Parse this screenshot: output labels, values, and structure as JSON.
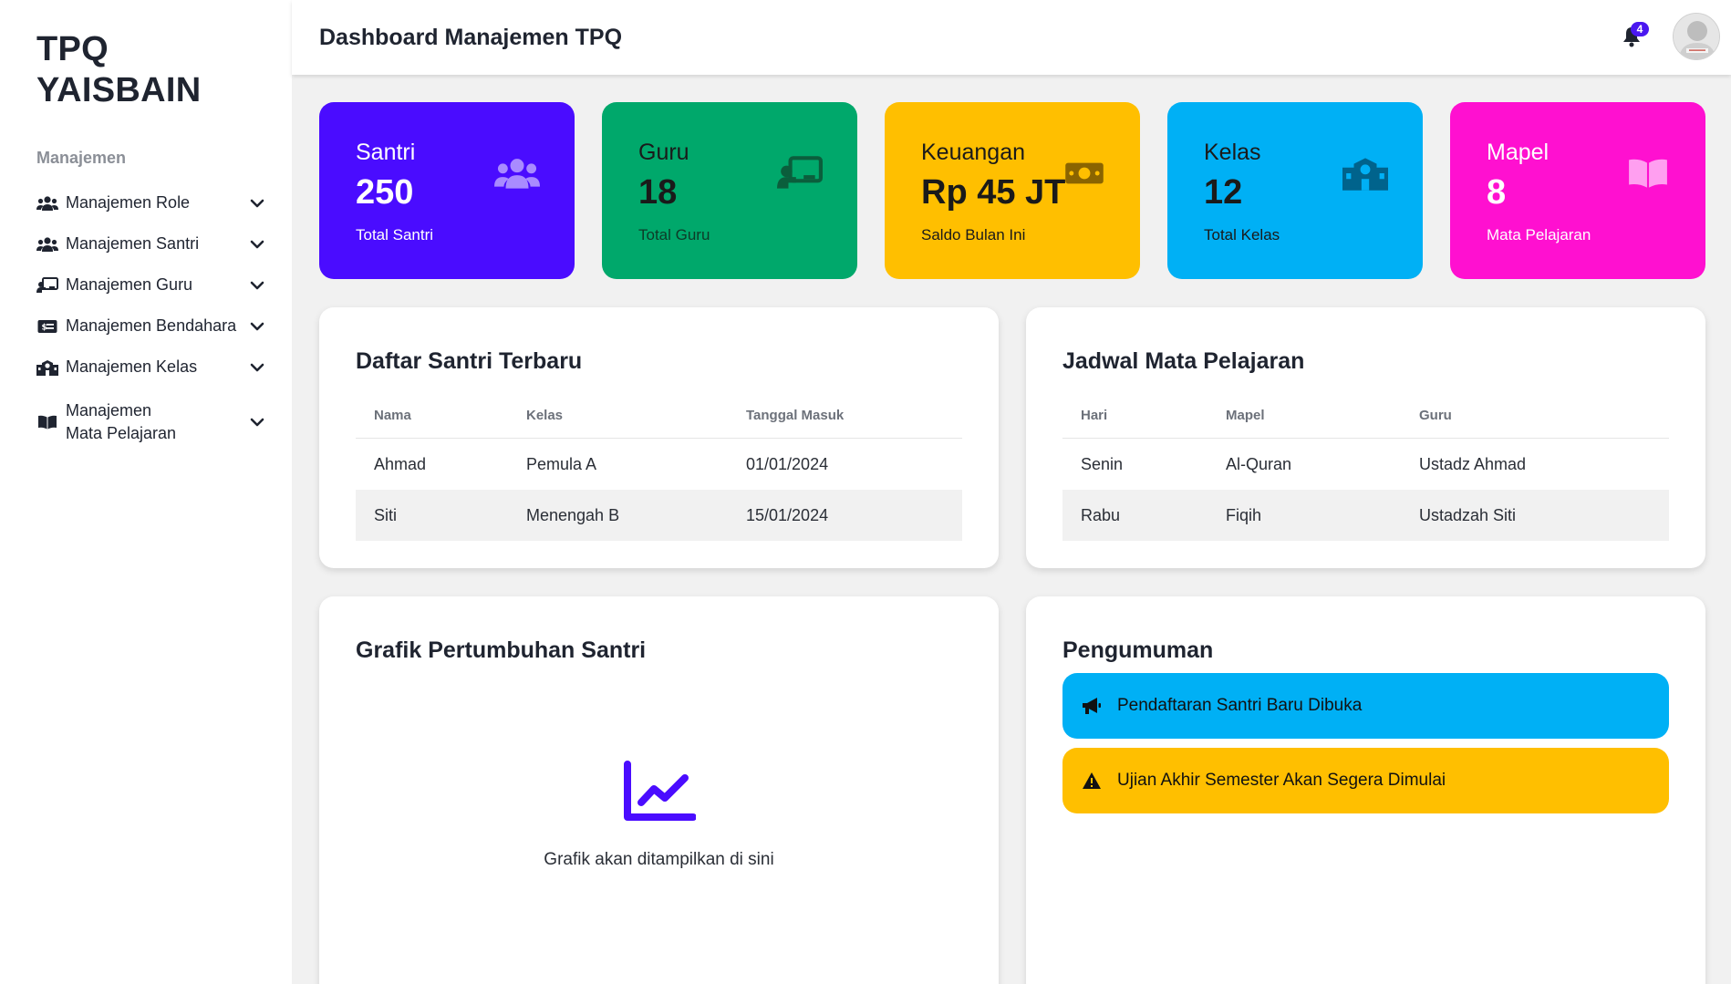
{
  "brand": {
    "line1": "TPQ",
    "line2": "YAISBAIN"
  },
  "sidebar": {
    "section_label": "Manajemen",
    "items": [
      {
        "label": "Manajemen Role",
        "icon": "users-icon"
      },
      {
        "label": "Manajemen Santri",
        "icon": "users-icon"
      },
      {
        "label": "Manajemen Guru",
        "icon": "teacher-board-icon"
      },
      {
        "label": "Manajemen Bendahara",
        "icon": "money-card-icon"
      },
      {
        "label": "Manajemen Kelas",
        "icon": "school-icon"
      },
      {
        "label_line1": "Manajemen",
        "label_line2": "Mata Pelajaran",
        "icon": "book-icon"
      }
    ]
  },
  "header": {
    "title": "Dashboard Manajemen TPQ",
    "notification_count": "4"
  },
  "stats": [
    {
      "title": "Santri",
      "value": "250",
      "sub": "Total Santri",
      "color": "#4a0cff",
      "icon": "users-icon"
    },
    {
      "title": "Guru",
      "value": "18",
      "sub": "Total Guru",
      "color": "#00a86b",
      "icon": "teacher-board-icon"
    },
    {
      "title": "Keuangan",
      "value": "Rp 45 JT",
      "sub": "Saldo Bulan Ini",
      "color": "#ffbf00",
      "icon": "money-bill-icon"
    },
    {
      "title": "Kelas",
      "value": "12",
      "sub": "Total Kelas",
      "color": "#00b0f5",
      "icon": "school-icon"
    },
    {
      "title": "Mapel",
      "value": "8",
      "sub": "Mata Pelajaran",
      "color": "#ff10d0",
      "icon": "book-open-icon"
    }
  ],
  "santri_table": {
    "title": "Daftar Santri Terbaru",
    "headers": [
      "Nama",
      "Kelas",
      "Tanggal Masuk"
    ],
    "rows": [
      [
        "Ahmad",
        "Pemula A",
        "01/01/2024"
      ],
      [
        "Siti",
        "Menengah B",
        "15/01/2024"
      ]
    ]
  },
  "jadwal_table": {
    "title": "Jadwal Mata Pelajaran",
    "headers": [
      "Hari",
      "Mapel",
      "Guru"
    ],
    "rows": [
      [
        "Senin",
        "Al-Quran",
        "Ustadz Ahmad"
      ],
      [
        "Rabu",
        "Fiqih",
        "Ustadzah Siti"
      ]
    ]
  },
  "grafik": {
    "title": "Grafik Pertumbuhan Santri",
    "caption": "Grafik akan ditampilkan di sini"
  },
  "pengumuman": {
    "title": "Pengumuman",
    "items": [
      {
        "text": "Pendaftaran Santri Baru Dibuka",
        "color": "#00b0f5",
        "icon": "megaphone-icon"
      },
      {
        "text": "Ujian Akhir Semester Akan Segera Dimulai",
        "color": "#ffbf00",
        "icon": "warning-icon"
      }
    ]
  }
}
